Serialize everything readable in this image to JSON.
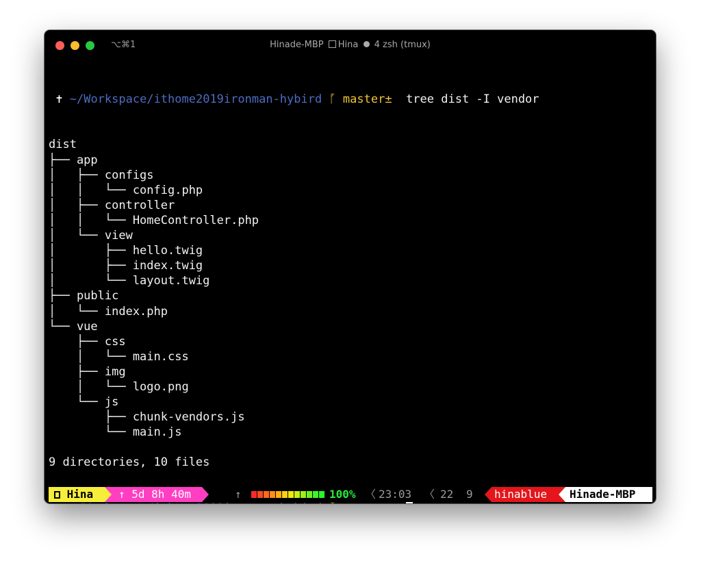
{
  "titlebar": {
    "shortcut": "⌥⌘1",
    "host": "Hinade-MBP",
    "session": "Hina",
    "window": "4 zsh (tmux)"
  },
  "prompt": {
    "symbol": "✝",
    "path": "~/Workspace/ithome2019ironman-hybird",
    "branch_icon": "ᚵ",
    "branch": "master±",
    "command": "tree dist -I vendor"
  },
  "tree_lines": [
    "dist",
    "├── app",
    "│   ├── configs",
    "│   │   └── config.php",
    "│   ├── controller",
    "│   │   └── HomeController.php",
    "│   └── view",
    "│       ├── hello.twig",
    "│       ├── index.twig",
    "│       └── layout.twig",
    "├── public",
    "│   └── index.php",
    "└── vue",
    "    ├── css",
    "    │   └── main.css",
    "    ├── img",
    "    │   └── logo.png",
    "    └── js",
    "        ├── chunk-vendors.js",
    "        └── main.js",
    "",
    "9 directories, 10 files"
  ],
  "status": {
    "session": "Hina",
    "uptime": "↑ 5d 8h 40m",
    "up_arrow": "↑",
    "battery_colors": [
      "#ff2a2a",
      "#ff4a1f",
      "#ff6a1a",
      "#ff8c16",
      "#ffae12",
      "#ffd00e",
      "#f0e80c",
      "#c8ee12",
      "#9df018",
      "#6ef21f",
      "#3ef426",
      "#2af52c"
    ],
    "battery_pct": "100%",
    "sep": "〈",
    "time": "23:03",
    "window_index": "22",
    "pane_index": "9",
    "user": "hinablue",
    "host": "Hinade-MBP"
  },
  "colors": {
    "background": "#000000",
    "path": "#4d6cc2",
    "branch": "#f0c43a",
    "session_bg": "#f7ee3c",
    "uptime_bg": "#ff3ec2",
    "user_bg": "#e4161b",
    "host_bg": "#ffffff",
    "battery_pct": "#29e83b"
  }
}
